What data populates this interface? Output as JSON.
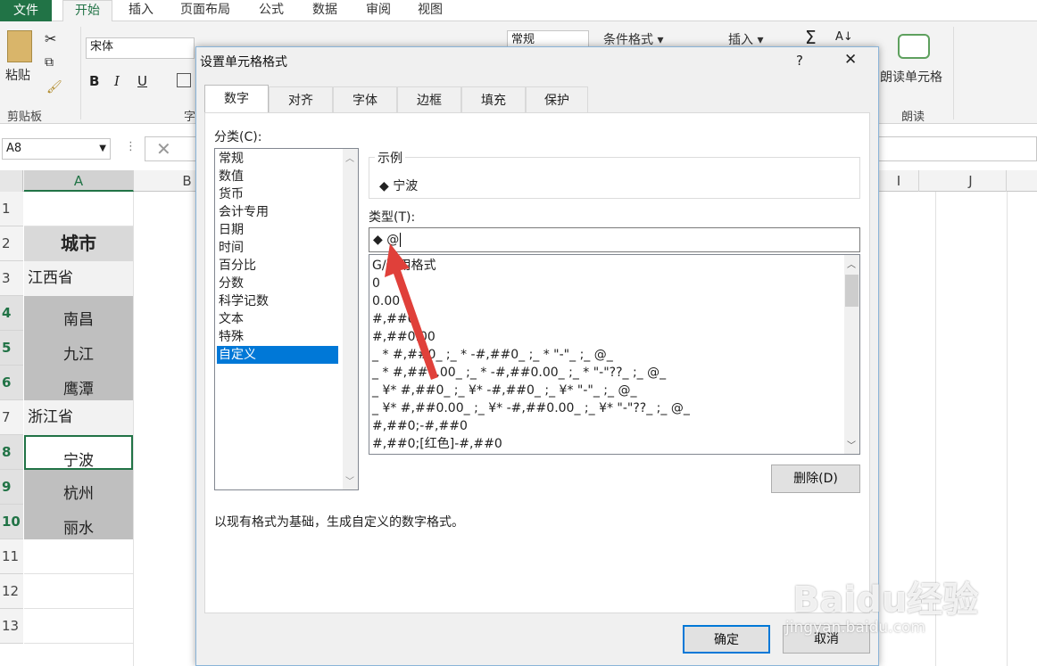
{
  "ribbon": {
    "tabs": [
      "文件",
      "开始",
      "插入",
      "页面布局",
      "公式",
      "数据",
      "审阅",
      "视图"
    ],
    "paste_label": "粘贴",
    "clipboard_group": "剪贴板",
    "font_name": "宋体",
    "font_group_partial": "字",
    "number_format": "常规",
    "conditional_format": "条件格式",
    "insert_label": "插入",
    "read_cell": "朗读单元格",
    "read_group": "朗读"
  },
  "formula": {
    "name_box": "A8"
  },
  "sheet": {
    "columns": [
      "A",
      "B",
      "I",
      "J"
    ],
    "rows": [
      "1",
      "2",
      "3",
      "4",
      "5",
      "6",
      "7",
      "8",
      "9",
      "10",
      "11",
      "12",
      "13"
    ],
    "cells": [
      "",
      "城市",
      "江西省",
      "南昌",
      "九江",
      "鹰潭",
      "浙江省",
      "宁波",
      "杭州",
      "丽水",
      "",
      "",
      ""
    ]
  },
  "dialog": {
    "title": "设置单元格格式",
    "help": "?",
    "close": "✕",
    "tabs": [
      "数字",
      "对齐",
      "字体",
      "边框",
      "填充",
      "保护"
    ],
    "category_label": "分类(C):",
    "categories": [
      "常规",
      "数值",
      "货币",
      "会计专用",
      "日期",
      "时间",
      "百分比",
      "分数",
      "科学记数",
      "文本",
      "特殊",
      "自定义"
    ],
    "selected_category": "自定义",
    "sample_label": "示例",
    "sample_value": "◆ 宁波",
    "type_label": "类型(T):",
    "type_value": "◆ @",
    "formats": [
      "G/通用格式",
      "0",
      "0.00",
      "#,##0",
      "#,##0.00",
      "_ * #,##0_ ;_ * -#,##0_ ;_ * \"-\"_ ;_ @_",
      "_ * #,##0.00_ ;_ * -#,##0.00_ ;_ * \"-\"??_ ;_ @_",
      "_ ¥* #,##0_ ;_ ¥* -#,##0_ ;_ ¥* \"-\"_ ;_ @_",
      "_ ¥* #,##0.00_ ;_ ¥* -#,##0.00_ ;_ ¥* \"-\"??_ ;_ @_",
      "#,##0;-#,##0",
      "#,##0;[红色]-#,##0"
    ],
    "delete_button": "删除(D)",
    "description": "以现有格式为基础，生成自定义的数字格式。",
    "ok_button": "确定",
    "cancel_button": "取消"
  },
  "watermark": {
    "text": "Baidu经验",
    "url": "jingyan.baidu.com"
  },
  "colors": {
    "accent": "#217346",
    "selection": "#0078d7",
    "arrow": "#e0403a",
    "cell_fill": "#bfbfbf"
  }
}
